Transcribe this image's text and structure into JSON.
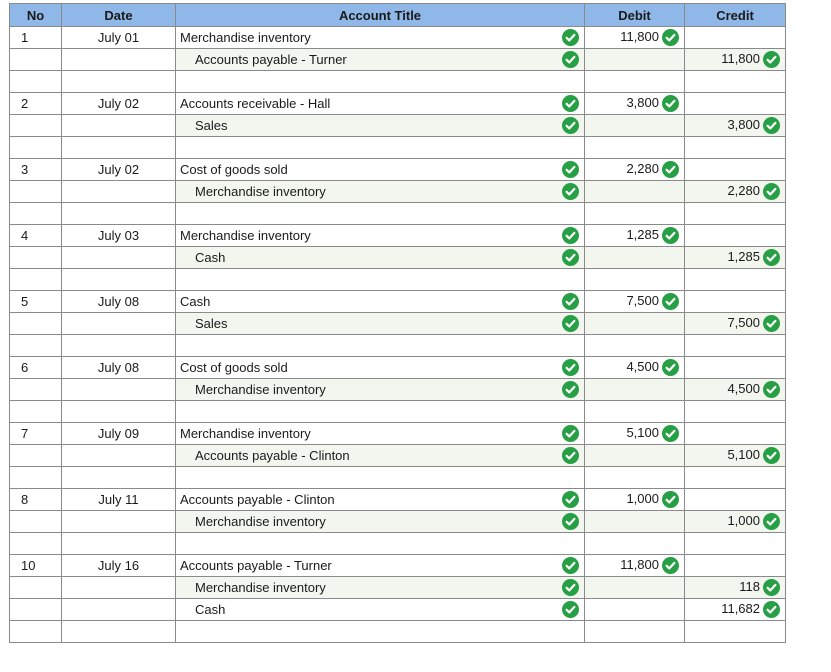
{
  "headers": {
    "no": "No",
    "date": "Date",
    "account": "Account Title",
    "debit": "Debit",
    "credit": "Credit"
  },
  "colors": {
    "header_bg": "#8fb7e8",
    "check_green": "#27a045",
    "row_shade": "#f2f6ef"
  },
  "icons": {
    "status": "check-circle-icon"
  },
  "entries": [
    {
      "no": "1",
      "date": "July 01",
      "lines": [
        {
          "account": "Merchandise inventory",
          "indent": false,
          "debit": "11,800",
          "credit": ""
        },
        {
          "account": "Accounts payable - Turner",
          "indent": true,
          "debit": "",
          "credit": "11,800"
        }
      ]
    },
    {
      "no": "2",
      "date": "July 02",
      "lines": [
        {
          "account": "Accounts receivable - Hall",
          "indent": false,
          "debit": "3,800",
          "credit": ""
        },
        {
          "account": "Sales",
          "indent": true,
          "debit": "",
          "credit": "3,800"
        }
      ]
    },
    {
      "no": "3",
      "date": "July 02",
      "lines": [
        {
          "account": "Cost of goods sold",
          "indent": false,
          "debit": "2,280",
          "credit": ""
        },
        {
          "account": "Merchandise inventory",
          "indent": true,
          "debit": "",
          "credit": "2,280"
        }
      ]
    },
    {
      "no": "4",
      "date": "July 03",
      "lines": [
        {
          "account": "Merchandise inventory",
          "indent": false,
          "debit": "1,285",
          "credit": ""
        },
        {
          "account": "Cash",
          "indent": true,
          "debit": "",
          "credit": "1,285"
        }
      ]
    },
    {
      "no": "5",
      "date": "July 08",
      "lines": [
        {
          "account": "Cash",
          "indent": false,
          "debit": "7,500",
          "credit": ""
        },
        {
          "account": "Sales",
          "indent": true,
          "debit": "",
          "credit": "7,500"
        }
      ]
    },
    {
      "no": "6",
      "date": "July 08",
      "lines": [
        {
          "account": "Cost of goods sold",
          "indent": false,
          "debit": "4,500",
          "credit": ""
        },
        {
          "account": "Merchandise inventory",
          "indent": true,
          "debit": "",
          "credit": "4,500"
        }
      ]
    },
    {
      "no": "7",
      "date": "July 09",
      "lines": [
        {
          "account": "Merchandise inventory",
          "indent": false,
          "debit": "5,100",
          "credit": ""
        },
        {
          "account": "Accounts payable - Clinton",
          "indent": true,
          "debit": "",
          "credit": "5,100"
        }
      ]
    },
    {
      "no": "8",
      "date": "July 11",
      "lines": [
        {
          "account": "Accounts payable - Clinton",
          "indent": false,
          "debit": "1,000",
          "credit": ""
        },
        {
          "account": "Merchandise inventory",
          "indent": true,
          "debit": "",
          "credit": "1,000"
        }
      ]
    },
    {
      "no": "10",
      "date": "July 16",
      "lines": [
        {
          "account": "Accounts payable - Turner",
          "indent": false,
          "debit": "11,800",
          "credit": ""
        },
        {
          "account": "Merchandise inventory",
          "indent": true,
          "debit": "",
          "credit": "118"
        },
        {
          "account": "Cash",
          "indent": true,
          "debit": "",
          "credit": "11,682"
        }
      ]
    }
  ]
}
